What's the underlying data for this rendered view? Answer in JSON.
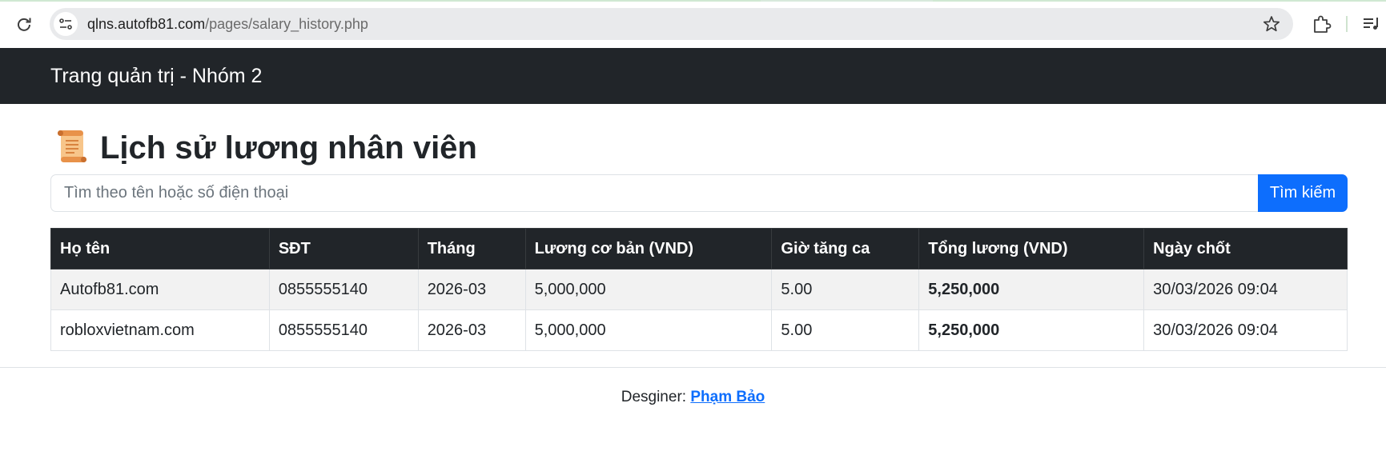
{
  "browser": {
    "url_host": "qlns.autofb81.com",
    "url_path": "/pages/salary_history.php",
    "icons": [
      "reload-icon",
      "site-info-icon",
      "star-icon",
      "extensions-icon",
      "media-controls-icon"
    ]
  },
  "navbar": {
    "brand": "Trang quản trị - Nhóm 2"
  },
  "page": {
    "title": "Lịch sử lương nhân viên",
    "title_icon": "scroll-icon"
  },
  "search": {
    "placeholder": "Tìm theo tên hoặc số điện thoại",
    "value": "",
    "button_label": "Tìm kiếm"
  },
  "table": {
    "headers": [
      "Họ tên",
      "SĐT",
      "Tháng",
      "Lương cơ bản (VND)",
      "Giờ tăng ca",
      "Tổng lương (VND)",
      "Ngày chốt"
    ],
    "rows": [
      [
        "Autofb81.com",
        "0855555140",
        "2026-03",
        "5,000,000",
        "5.00",
        "5,250,000",
        "30/03/2026 09:04"
      ],
      [
        "robloxvietnam.com",
        "0855555140",
        "2026-03",
        "5,000,000",
        "5.00",
        "5,250,000",
        "30/03/2026 09:04"
      ]
    ]
  },
  "footer": {
    "label": "Desginer:",
    "author": "Phạm Bảo"
  },
  "colors": {
    "navbar_bg": "#212529",
    "primary": "#0d6efd",
    "table_head_bg": "#212529",
    "row_stripe": "#f2f2f2"
  }
}
